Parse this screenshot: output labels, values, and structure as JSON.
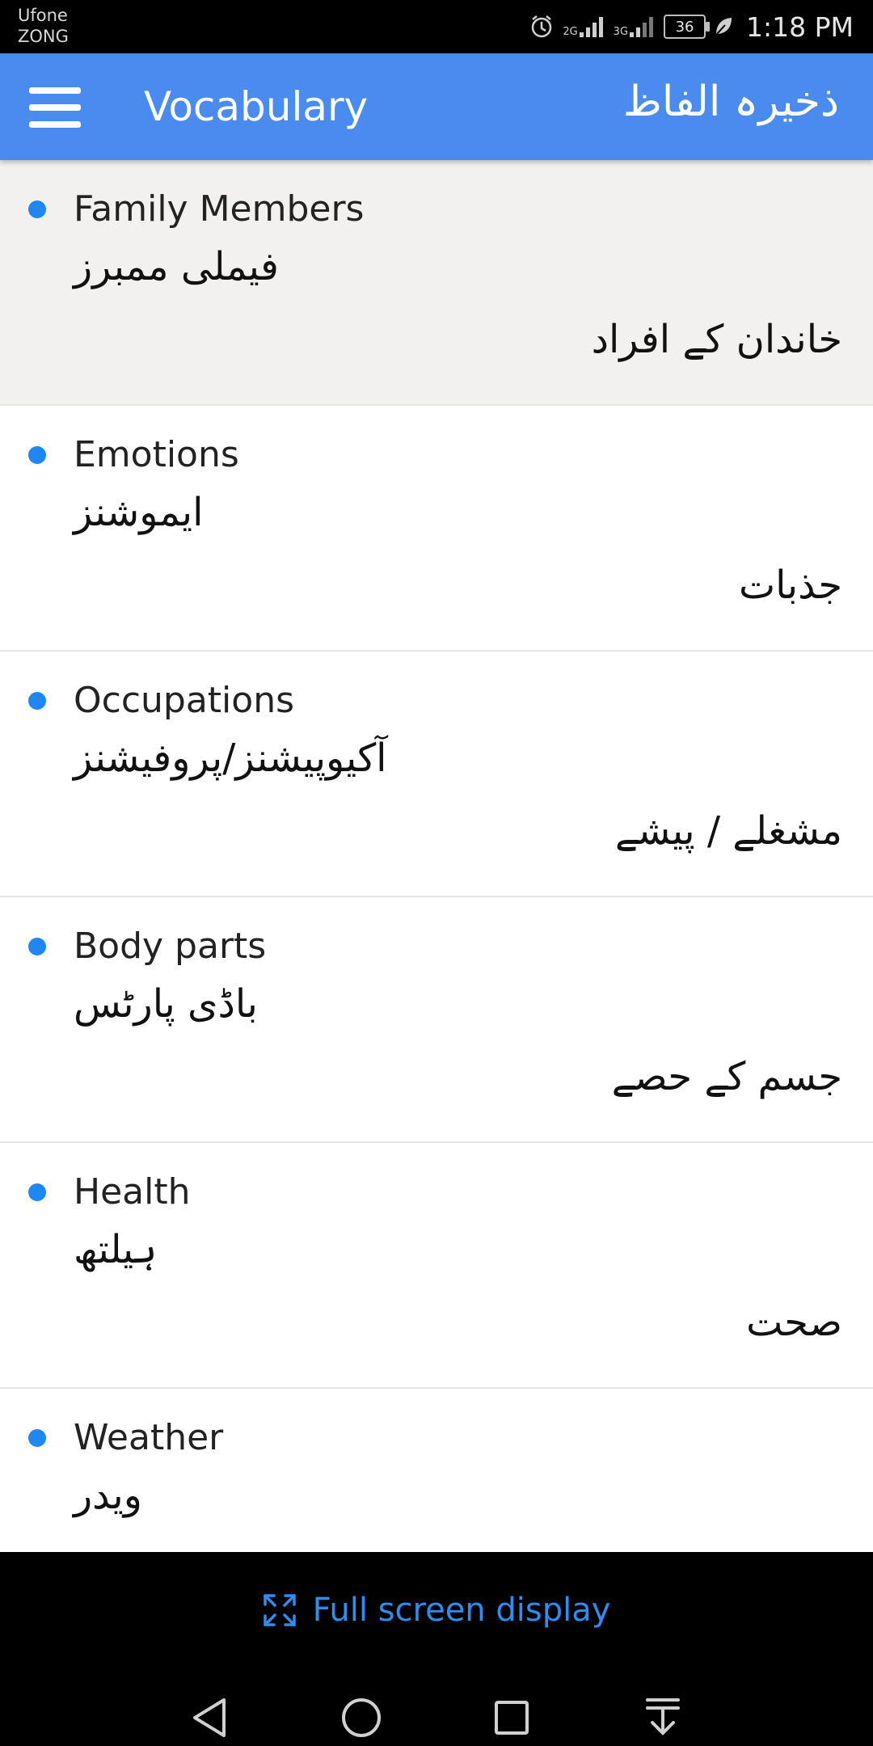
{
  "status_bar": {
    "carrier_1": "Ufone",
    "carrier_2": "ZONG",
    "network_1": "2G",
    "network_2": "3G",
    "battery": "36",
    "time": "1:18 PM"
  },
  "app_bar": {
    "title": "Vocabulary",
    "title_urdu": "ذخیرہ الفاظ"
  },
  "items": [
    {
      "en": "Family Members",
      "translit": "فیملی ممبرز",
      "urdu": "خاندان کے افراد"
    },
    {
      "en": "Emotions",
      "translit": "ایموشنز",
      "urdu": "جذبات"
    },
    {
      "en": "Occupations",
      "translit": "آکیوپیشنز/پروفیشنز",
      "urdu": "مشغلے / پیشے"
    },
    {
      "en": "Body parts",
      "translit": "باڈی پارٹس",
      "urdu": "جسم کے حصے"
    },
    {
      "en": "Health",
      "translit": "ہیلتھ",
      "urdu": "صحت"
    },
    {
      "en": "Weather",
      "translit": "ویدر",
      "urdu": ""
    }
  ],
  "bottom": {
    "fullscreen_label": "Full screen display"
  },
  "colors": {
    "app_bar": "#4a8bef",
    "bullet": "#1e88f0",
    "selected_row": "#f2f1f0",
    "accent_text": "#2f8cf0"
  }
}
